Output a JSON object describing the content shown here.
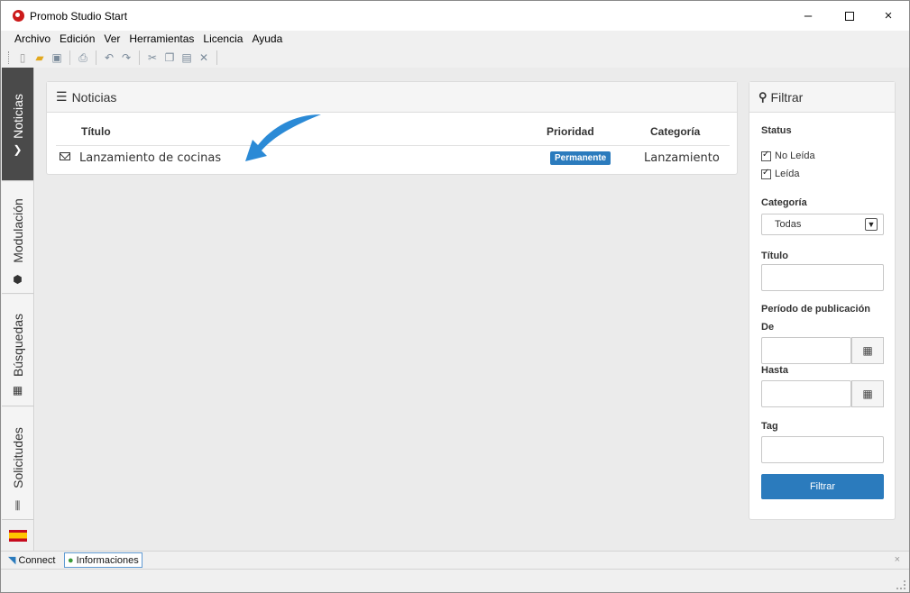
{
  "window": {
    "title": "Promob Studio Start",
    "min_glyph": "–",
    "close_glyph": "×"
  },
  "menu": [
    "Archivo",
    "Edición",
    "Ver",
    "Herramientas",
    "Licencia",
    "Ayuda"
  ],
  "toolbar": {
    "icons": [
      "new-document-icon",
      "open-folder-icon",
      "save-icon",
      "print-icon",
      "undo-icon",
      "redo-icon",
      "cut-icon",
      "copy-icon",
      "paste-icon",
      "delete-icon"
    ]
  },
  "left_tabs": [
    {
      "label": "Noticias",
      "icon": "arrow-right-icon",
      "active": true
    },
    {
      "label": "Modulación",
      "icon": "cube-icon",
      "active": false
    },
    {
      "label": "Búsquedas",
      "icon": "report-icon",
      "active": false
    },
    {
      "label": "Solicitudes",
      "icon": "tools-icon",
      "active": false
    }
  ],
  "language_flag": "spain-flag-icon",
  "news": {
    "title": "Noticias",
    "columns": {
      "titulo": "Título",
      "prioridad": "Prioridad",
      "categoria": "Categoría"
    },
    "rows": [
      {
        "titulo": "Lanzamiento de cocinas",
        "prioridad": "Permanente",
        "categoria": "Lanzamiento"
      }
    ]
  },
  "filter": {
    "title": "Filtrar",
    "status_label": "Status",
    "status_options": [
      {
        "label": "No Leída",
        "checked": true
      },
      {
        "label": "Leída",
        "checked": true
      }
    ],
    "categoria_label": "Categoría",
    "categoria_value": "Todas",
    "titulo_label": "Título",
    "titulo_value": "",
    "periodo_label": "Período de publicación",
    "de_label": "De",
    "hasta_label": "Hasta",
    "tag_label": "Tag",
    "button": "Filtrar"
  },
  "statusbar": {
    "connect": "Connect",
    "informaciones": "Informaciones",
    "close_glyph": "×"
  },
  "colors": {
    "accent": "#2b7bbd",
    "active_tab": "#4a4a4a",
    "arrow": "#2b8ad6"
  }
}
